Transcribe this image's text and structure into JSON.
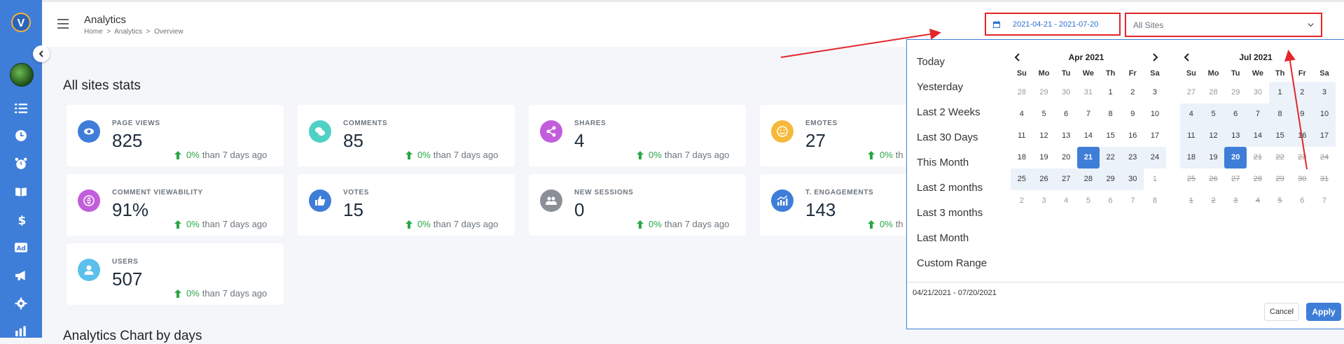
{
  "app": {
    "logo_letter": "V",
    "title": "Analytics"
  },
  "breadcrumb": [
    "Home",
    "Analytics",
    "Overview"
  ],
  "toolbar": {
    "date_range": "2021-04-21 - 2021-07-20",
    "site_select": "All Sites"
  },
  "section_title": "All sites stats",
  "chart_title": "Analytics Chart by days",
  "stats": [
    {
      "label": "PAGE VIEWS",
      "value": "825",
      "change": "0%",
      "suffix": "than 7 days ago",
      "icon": "eye-icon",
      "color": "#3f7ed8"
    },
    {
      "label": "COMMENTS",
      "value": "85",
      "change": "0%",
      "suffix": "than 7 days ago",
      "icon": "comments-icon",
      "color": "#4fd1c5"
    },
    {
      "label": "SHARES",
      "value": "4",
      "change": "0%",
      "suffix": "than 7 days ago",
      "icon": "share-icon",
      "color": "#c25ddb"
    },
    {
      "label": "EMOTES",
      "value": "27",
      "change": "0%",
      "suffix": "th",
      "icon": "smile-icon",
      "color": "#f6b93b"
    },
    {
      "label": "COMMENT VIEWABILITY",
      "value": "91%",
      "change": "0%",
      "suffix": "than 7 days ago",
      "icon": "viewability-icon",
      "color": "#c25ddb"
    },
    {
      "label": "VOTES",
      "value": "15",
      "change": "0%",
      "suffix": "than 7 days ago",
      "icon": "thumbs-up-icon",
      "color": "#3f7ed8"
    },
    {
      "label": "NEW SESSIONS",
      "value": "0",
      "change": "0%",
      "suffix": "than 7 days ago",
      "icon": "users-group-icon",
      "color": "#8a8f98"
    },
    {
      "label": "T. ENGAGEMENTS",
      "value": "143",
      "change": "0%",
      "suffix": "th",
      "icon": "chart-icon",
      "color": "#3f7ed8"
    },
    {
      "label": "USERS",
      "value": "507",
      "change": "0%",
      "suffix": "than 7 days ago",
      "icon": "user-icon",
      "color": "#5bc0eb"
    }
  ],
  "picker": {
    "ranges": [
      "Today",
      "Yesterday",
      "Last 2 Weeks",
      "Last 30 Days",
      "This Month",
      "Last 2 months",
      "Last 3 months",
      "Last Month",
      "Custom Range"
    ],
    "weekdays": [
      "Su",
      "Mo",
      "Tu",
      "We",
      "Th",
      "Fr",
      "Sa"
    ],
    "left_month": "Apr 2021",
    "right_month": "Jul 2021",
    "left_days": [
      [
        "28",
        "off"
      ],
      [
        "29",
        "off"
      ],
      [
        "30",
        "off"
      ],
      [
        "31",
        "off"
      ],
      [
        "1",
        ""
      ],
      [
        "2",
        ""
      ],
      [
        "3",
        ""
      ],
      [
        "4",
        ""
      ],
      [
        "5",
        ""
      ],
      [
        "6",
        ""
      ],
      [
        "7",
        ""
      ],
      [
        "8",
        ""
      ],
      [
        "9",
        ""
      ],
      [
        "10",
        ""
      ],
      [
        "11",
        ""
      ],
      [
        "12",
        ""
      ],
      [
        "13",
        ""
      ],
      [
        "14",
        ""
      ],
      [
        "15",
        ""
      ],
      [
        "16",
        ""
      ],
      [
        "17",
        ""
      ],
      [
        "18",
        ""
      ],
      [
        "19",
        ""
      ],
      [
        "20",
        ""
      ],
      [
        "21",
        "sel"
      ],
      [
        "22",
        "inrange"
      ],
      [
        "23",
        "inrange"
      ],
      [
        "24",
        "inrange"
      ],
      [
        "25",
        "inrange"
      ],
      [
        "26",
        "inrange"
      ],
      [
        "27",
        "inrange"
      ],
      [
        "28",
        "inrange"
      ],
      [
        "29",
        "inrange"
      ],
      [
        "30",
        "inrange"
      ],
      [
        "1",
        "off"
      ],
      [
        "2",
        "off"
      ],
      [
        "3",
        "off"
      ],
      [
        "4",
        "off"
      ],
      [
        "5",
        "off"
      ],
      [
        "6",
        "off"
      ],
      [
        "7",
        "off"
      ],
      [
        "8",
        "off"
      ]
    ],
    "right_days": [
      [
        "27",
        "off"
      ],
      [
        "28",
        "off"
      ],
      [
        "29",
        "off"
      ],
      [
        "30",
        "off"
      ],
      [
        "1",
        "inrange"
      ],
      [
        "2",
        "inrange"
      ],
      [
        "3",
        "inrange"
      ],
      [
        "4",
        "inrange"
      ],
      [
        "5",
        "inrange"
      ],
      [
        "6",
        "inrange"
      ],
      [
        "7",
        "inrange"
      ],
      [
        "8",
        "inrange"
      ],
      [
        "9",
        "inrange"
      ],
      [
        "10",
        "inrange"
      ],
      [
        "11",
        "inrange"
      ],
      [
        "12",
        "inrange"
      ],
      [
        "13",
        "inrange"
      ],
      [
        "14",
        "inrange"
      ],
      [
        "15",
        "inrange"
      ],
      [
        "16",
        "inrange"
      ],
      [
        "17",
        "inrange"
      ],
      [
        "18",
        "inrange"
      ],
      [
        "19",
        "inrange"
      ],
      [
        "20",
        "sel"
      ],
      [
        "21",
        "dis"
      ],
      [
        "22",
        "dis"
      ],
      [
        "23",
        "dis"
      ],
      [
        "24",
        "dis"
      ],
      [
        "25",
        "dis"
      ],
      [
        "26",
        "dis"
      ],
      [
        "27",
        "dis"
      ],
      [
        "28",
        "dis"
      ],
      [
        "29",
        "dis"
      ],
      [
        "30",
        "dis"
      ],
      [
        "31",
        "dis"
      ],
      [
        "1",
        "dis"
      ],
      [
        "2",
        "dis"
      ],
      [
        "3",
        "dis"
      ],
      [
        "4",
        "dis"
      ],
      [
        "5",
        "dis"
      ],
      [
        "6",
        "off"
      ],
      [
        "7",
        "off"
      ]
    ],
    "selected_text": "04/21/2021 - 07/20/2021",
    "cancel_label": "Cancel",
    "apply_label": "Apply"
  },
  "colors": {
    "accent": "#3f7ed8",
    "annotation": "#e3262a",
    "positive": "#28a745"
  }
}
